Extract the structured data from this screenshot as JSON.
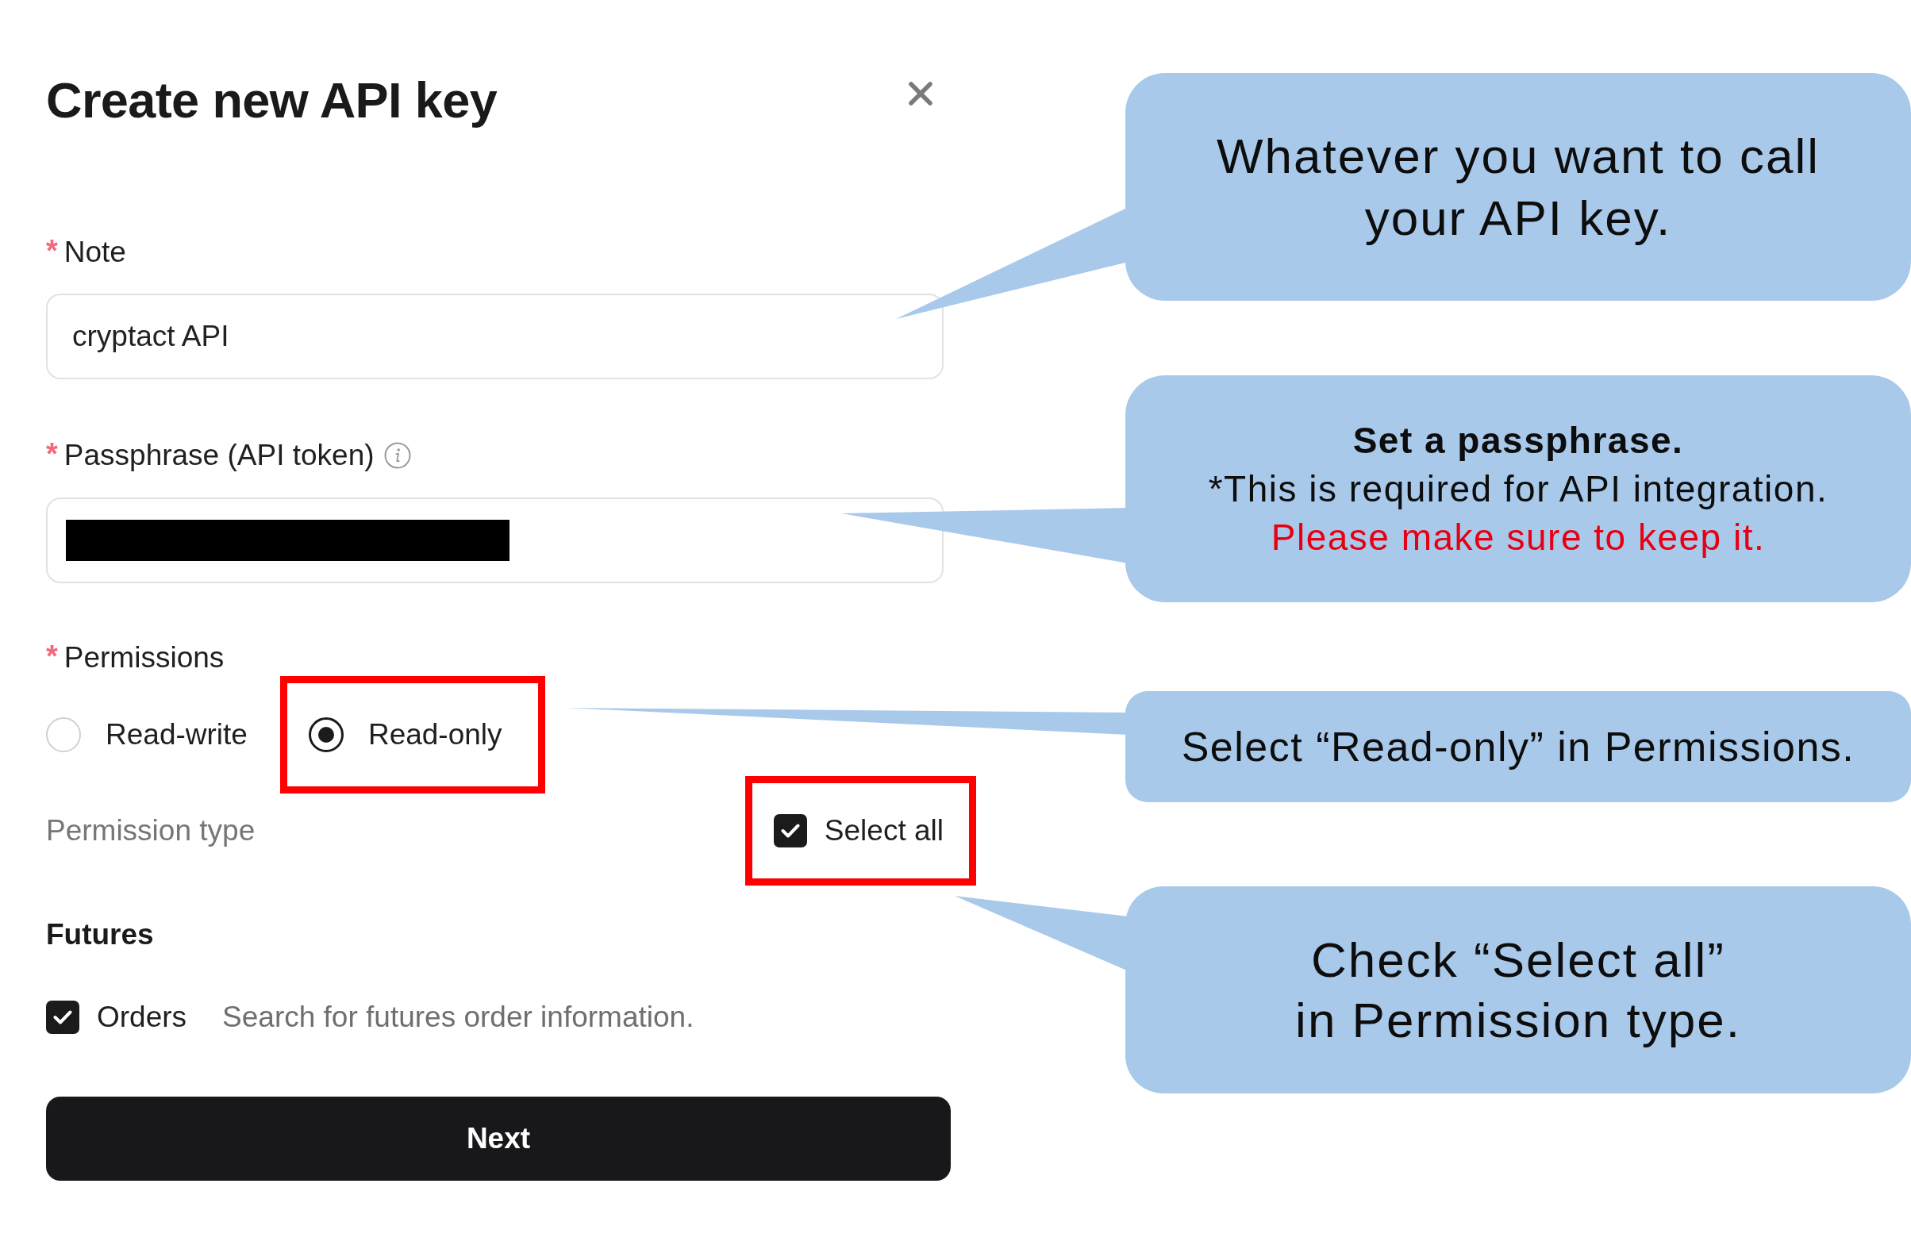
{
  "dialog": {
    "title": "Create new API key",
    "fields": [
      {
        "kind": "text",
        "required_mark": "*",
        "label": "Note",
        "value": "cryptact API"
      },
      {
        "kind": "secret",
        "required_mark": "*",
        "label": "Passphrase (API token)",
        "info_icon": true,
        "redacted": true
      }
    ],
    "permissions": {
      "required_mark": "*",
      "label": "Permissions",
      "options": [
        {
          "label": "Read-write",
          "selected": false,
          "highlighted": false
        },
        {
          "label": "Read-only",
          "selected": true,
          "highlighted": true
        }
      ]
    },
    "permission_type": {
      "label": "Permission type",
      "select_all": {
        "label": "Select all",
        "checked": true,
        "highlighted": true
      }
    },
    "groups": [
      {
        "title": "Futures",
        "items": [
          {
            "label": "Orders",
            "description": "Search for futures order information.",
            "checked": true
          }
        ]
      }
    ],
    "submit_button": "Next"
  },
  "callouts": [
    {
      "paragraphs": [
        {
          "kind": "plain",
          "text": "Whatever you want to call your API key."
        }
      ]
    },
    {
      "paragraphs": [
        {
          "kind": "bold",
          "text": "Set a passphrase."
        },
        {
          "kind": "plain",
          "text": "*This is required for API integration."
        },
        {
          "kind": "warning",
          "text": "Please make sure to keep it."
        }
      ]
    },
    {
      "paragraphs": [
        {
          "kind": "plain",
          "text": "Select “Read-only” in Permissions."
        }
      ]
    },
    {
      "paragraphs": [
        {
          "kind": "plain",
          "text": "Check “Select all” in Permission type."
        }
      ]
    }
  ]
}
